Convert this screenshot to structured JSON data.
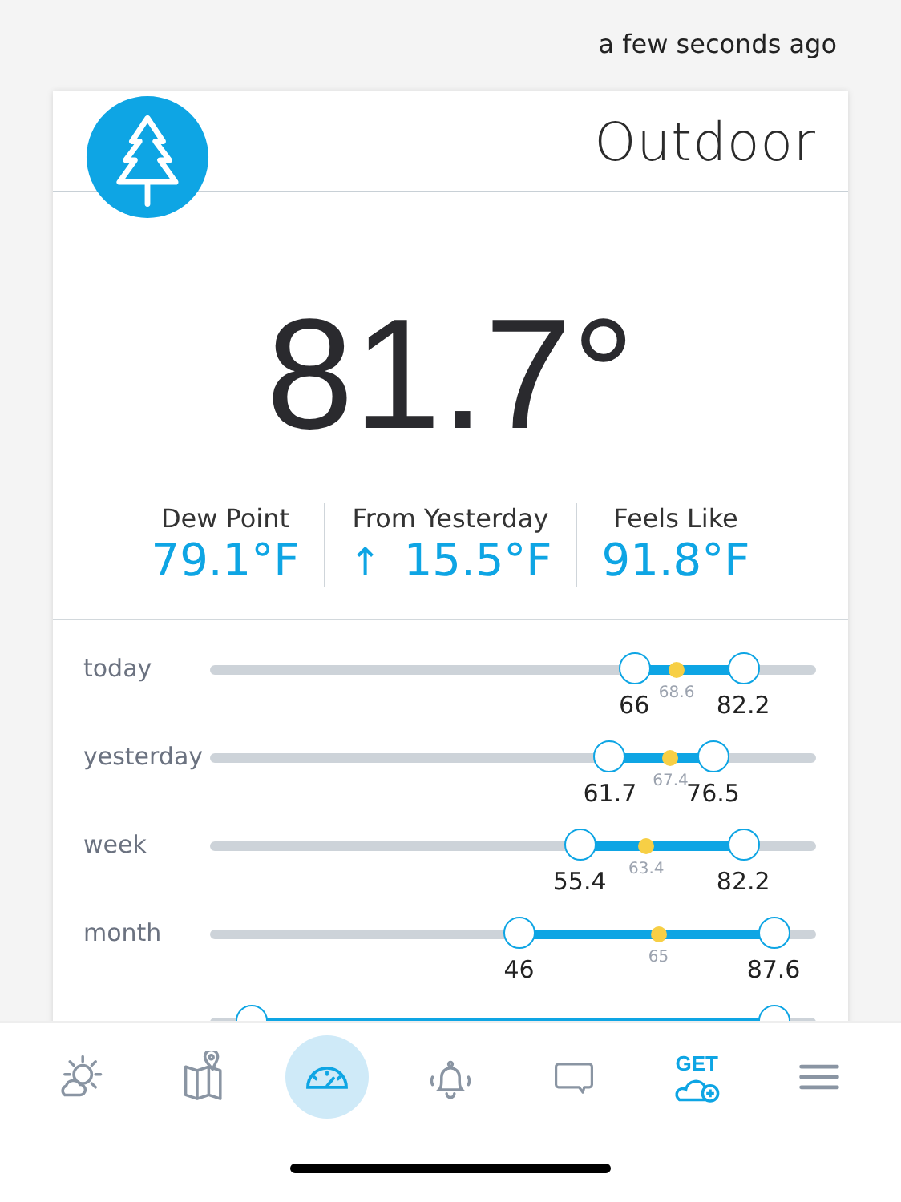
{
  "updated": "a few seconds ago",
  "card": {
    "title": "Outdoor",
    "temperature": "81.7°",
    "stats": [
      {
        "label": "Dew Point",
        "value": "79.1°F"
      },
      {
        "label": "From Yesterday",
        "arrow": "↑",
        "value": "15.5°F"
      },
      {
        "label": "Feels Like",
        "value": "91.8°F"
      }
    ],
    "ranges": [
      {
        "label": "today",
        "low_text": "66",
        "high_text": "82.2",
        "mean_text": "68.6",
        "low": {
          "level": 0.7
        },
        "high": {
          "level": 0.88
        },
        "mean": {
          "level": 0.77
        }
      },
      {
        "label": "yesterday",
        "low_text": "61.7",
        "high_text": "76.5",
        "mean_text": "67.4",
        "low": {
          "level": 0.66
        },
        "high": {
          "level": 0.83
        },
        "mean": {
          "level": 0.76
        }
      },
      {
        "label": "week",
        "low_text": "55.4",
        "high_text": "82.2",
        "mean_text": "63.4",
        "low": {
          "level": 0.61
        },
        "high": {
          "level": 0.88
        },
        "mean": {
          "level": 0.72
        }
      },
      {
        "label": "month",
        "low_text": "46",
        "high_text": "87.6",
        "mean_text": "65",
        "low": {
          "level": 0.51
        },
        "high": {
          "level": 0.93
        },
        "mean": {
          "level": 0.74
        }
      },
      {
        "low": {
          "level": 0.07
        },
        "high": {
          "level": 0.93
        }
      }
    ]
  },
  "nav": [
    {
      "kind": "weather",
      "selected": false
    },
    {
      "kind": "map",
      "selected": false
    },
    {
      "kind": "dashboard",
      "selected": true
    },
    {
      "kind": "alerts",
      "selected": false
    },
    {
      "kind": "chat",
      "selected": false
    },
    {
      "kind": "get",
      "label": "GET",
      "selected": false
    },
    {
      "kind": "menu",
      "selected": false
    }
  ]
}
